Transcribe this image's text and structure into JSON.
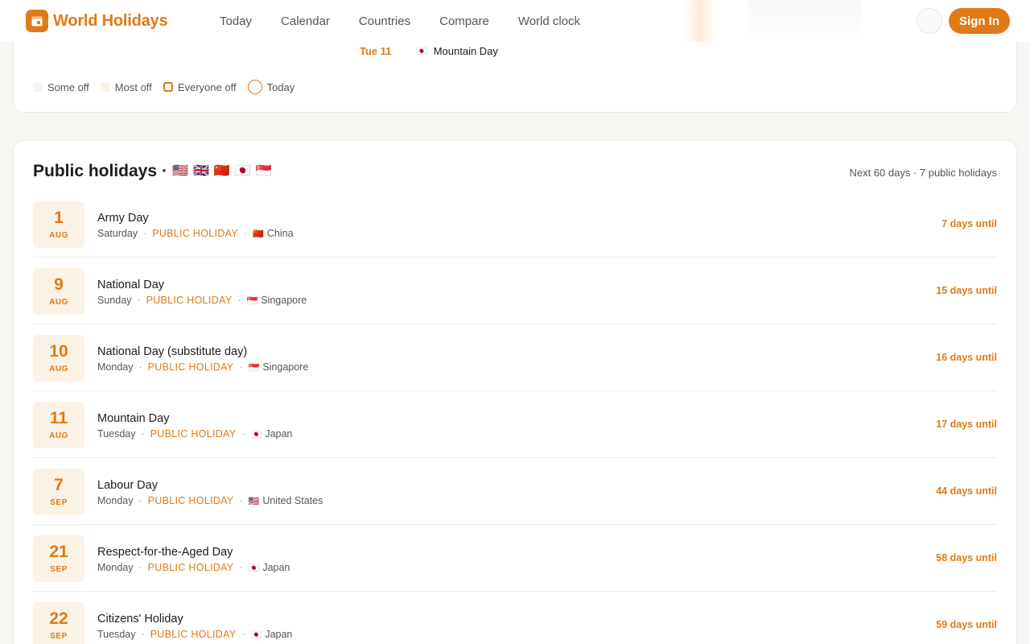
{
  "header": {
    "logo_text": "World Holidays",
    "nav": [
      "Today",
      "Calendar",
      "Countries",
      "Compare",
      "World clock"
    ],
    "sign_in": "Sign In"
  },
  "calendar_peek": {
    "date": "Tue 11",
    "flag": "🇯🇵",
    "holiday": "Mountain Day"
  },
  "legend": {
    "some_off": "Some off",
    "most_off": "Most off",
    "everyone_off": "Everyone off",
    "today": "Today"
  },
  "holidays_card": {
    "title": "Public holidays",
    "separator": "·",
    "flags": [
      "🇺🇸",
      "🇬🇧",
      "🇨🇳",
      "🇯🇵",
      "🇸🇬"
    ],
    "summary": "Next 60 days · 7 public holidays",
    "items": [
      {
        "day": "1",
        "month": "AUG",
        "name": "Army Day",
        "weekday": "Saturday",
        "type": "PUBLIC HOLIDAY",
        "flag": "🇨🇳",
        "country": "China",
        "until": "7 days until"
      },
      {
        "day": "9",
        "month": "AUG",
        "name": "National Day",
        "weekday": "Sunday",
        "type": "PUBLIC HOLIDAY",
        "flag": "🇸🇬",
        "country": "Singapore",
        "until": "15 days until"
      },
      {
        "day": "10",
        "month": "AUG",
        "name": "National Day (substitute day)",
        "weekday": "Monday",
        "type": "PUBLIC HOLIDAY",
        "flag": "🇸🇬",
        "country": "Singapore",
        "until": "16 days until"
      },
      {
        "day": "11",
        "month": "AUG",
        "name": "Mountain Day",
        "weekday": "Tuesday",
        "type": "PUBLIC HOLIDAY",
        "flag": "🇯🇵",
        "country": "Japan",
        "until": "17 days until"
      },
      {
        "day": "7",
        "month": "SEP",
        "name": "Labour Day",
        "weekday": "Monday",
        "type": "PUBLIC HOLIDAY",
        "flag": "🇺🇸",
        "country": "United States",
        "until": "44 days until"
      },
      {
        "day": "21",
        "month": "SEP",
        "name": "Respect-for-the-Aged Day",
        "weekday": "Monday",
        "type": "PUBLIC HOLIDAY",
        "flag": "🇯🇵",
        "country": "Japan",
        "until": "58 days until"
      },
      {
        "day": "22",
        "month": "SEP",
        "name": "Citizens' Holiday",
        "weekday": "Tuesday",
        "type": "PUBLIC HOLIDAY",
        "flag": "🇯🇵",
        "country": "Japan",
        "until": "59 days until"
      }
    ]
  },
  "colors": {
    "accent": "#e07a16",
    "badge_bg": "#fbf2e6",
    "page_bg": "#f7f6f3"
  }
}
